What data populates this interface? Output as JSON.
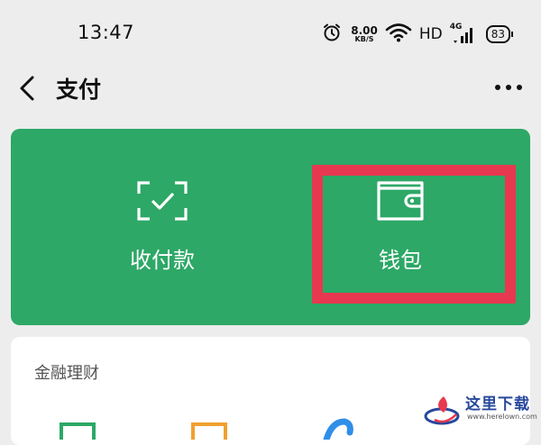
{
  "status_bar": {
    "time": "13:47",
    "network_speed": "8.00",
    "network_speed_unit": "KB/S",
    "hd_label": "HD",
    "network_type": "4G",
    "battery": "83"
  },
  "nav": {
    "title": "支付"
  },
  "pay_card": {
    "background_color": "#2da866",
    "actions": [
      {
        "label": "收付款",
        "icon": "scan-receive-icon"
      },
      {
        "label": "钱包",
        "icon": "wallet-icon"
      }
    ],
    "highlight_color": "#e8384f"
  },
  "finance": {
    "title": "金融理财",
    "items": [
      {
        "icon": "finance-green-icon",
        "color": "#2da866"
      },
      {
        "icon": "finance-orange-icon",
        "color": "#f0a030"
      },
      {
        "icon": "finance-blue-icon",
        "color": "#2f8fe8"
      }
    ]
  },
  "watermark": {
    "title": "这里下载",
    "url": "www.herelown.com"
  }
}
